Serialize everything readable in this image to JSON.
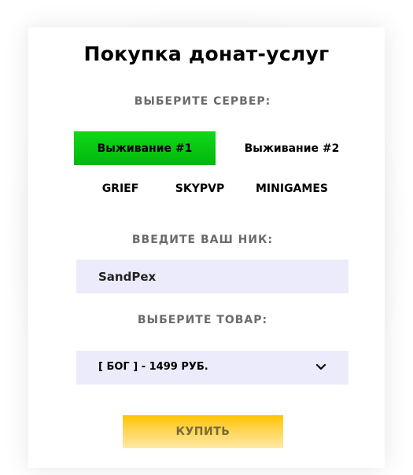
{
  "title": "Покупка донат-услуг",
  "server_section": {
    "label": "ВЫБЕРИТЕ СЕРВЕР:",
    "servers": [
      {
        "label": "Выживание #1",
        "selected": true
      },
      {
        "label": "Выживание #2",
        "selected": false
      },
      {
        "label": "GRIEF",
        "selected": false
      },
      {
        "label": "SKYPVP",
        "selected": false
      },
      {
        "label": "MINIGAMES",
        "selected": false
      }
    ]
  },
  "nick_section": {
    "label": "ВВЕДИТЕ ВАШ НИК:",
    "value": "SandPex"
  },
  "product_section": {
    "label": "ВЫБЕРИТЕ ТОВАР:",
    "selected": "[ БОГ ] - 1499 РУБ."
  },
  "buy_button": {
    "label": "КУПИТЬ"
  },
  "colors": {
    "active_server": "#11d81a",
    "field_background": "#ecebfb",
    "buy_button": "#ffc400"
  },
  "icons": {
    "dropdown": "chevron-down-icon"
  }
}
